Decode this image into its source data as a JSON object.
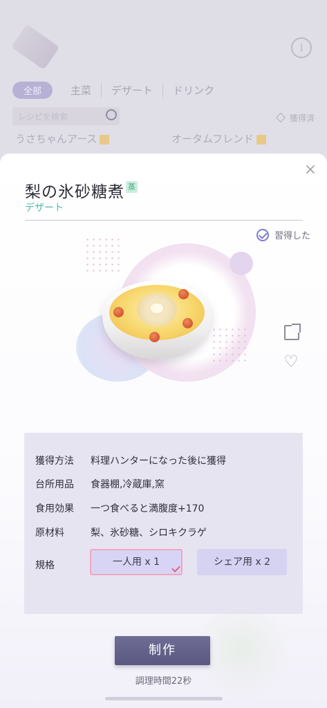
{
  "background": {
    "tabs": {
      "active": "全部",
      "items": [
        "主菜",
        "デザート",
        "ドリンク"
      ]
    },
    "search_placeholder": "レシピを検索",
    "owned_filter": "獲得済",
    "cards": [
      "うさちゃんアース",
      "オータムフレンド"
    ]
  },
  "dish": {
    "title": "梨の氷砂糖煮",
    "method_badge": "蒸",
    "category": "デザート",
    "learned_label": "習得した"
  },
  "info": {
    "rows": [
      {
        "label": "獲得方法",
        "value": "料理ハンターになった後に獲得"
      },
      {
        "label": "台所用品",
        "value": "食器棚,冷蔵庫,窯"
      },
      {
        "label": "食用効果",
        "value": "一つ食べると満腹度+170"
      },
      {
        "label": "原材料",
        "value": "梨、氷砂糖、シロキクラゲ"
      }
    ],
    "spec_label": "規格",
    "portions": {
      "single": "一人用 x 1",
      "share": "シェア用 x 2",
      "selected": "single"
    }
  },
  "actions": {
    "make_label": "制作",
    "cook_time": "調理時間22秒"
  },
  "icons": {
    "close": "close-icon",
    "learned": "check-circle-icon",
    "share": "share-icon",
    "favorite": "heart-icon"
  },
  "colors": {
    "accent_teal": "#4eb8ae",
    "panel": "#e7e4f2",
    "button": "#5f5d85",
    "selected_border": "#f0a6bf"
  }
}
